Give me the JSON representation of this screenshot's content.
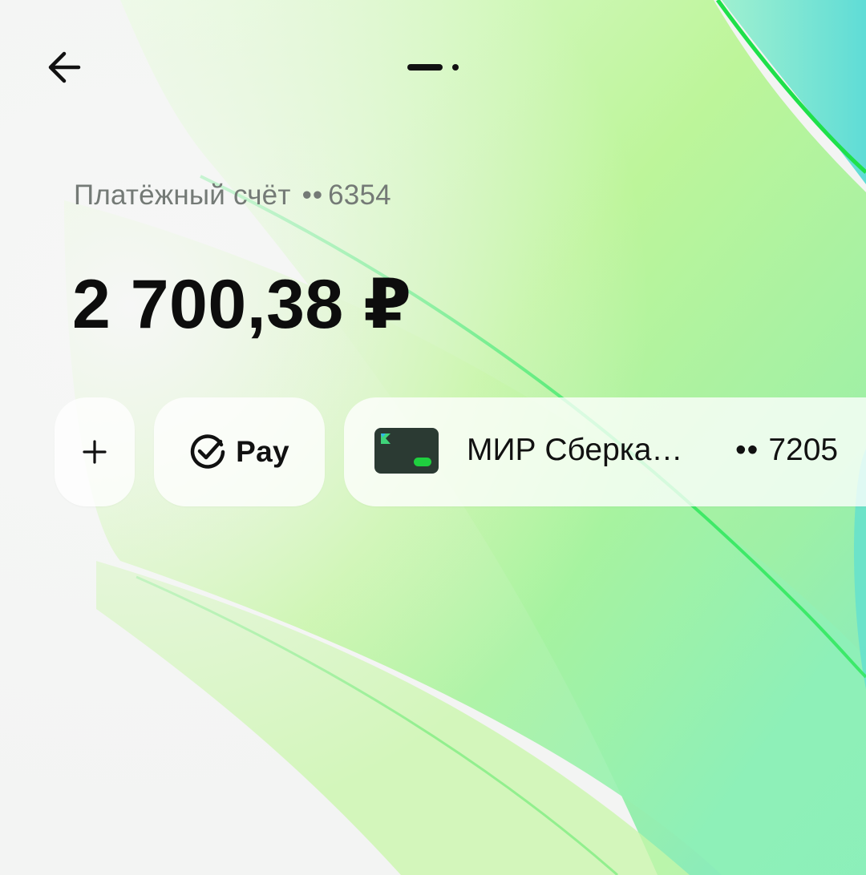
{
  "header": {
    "back_icon": "arrow-left-icon"
  },
  "account": {
    "name": "Платёжный счёт",
    "mask": "••",
    "number": "6354"
  },
  "balance": {
    "amount": "2 700,38 ₽"
  },
  "actions": {
    "add_label": "+",
    "pay_label": "Pay",
    "pay_icon": "check-circle-icon"
  },
  "card": {
    "name": "МИР Сберка…",
    "mask": "••",
    "number": "7205",
    "icon": "card-icon"
  },
  "colors": {
    "accent_green": "#21a038",
    "background_gradient_light": "#c8f59a",
    "background_gradient_teal": "#5fdcc6"
  }
}
